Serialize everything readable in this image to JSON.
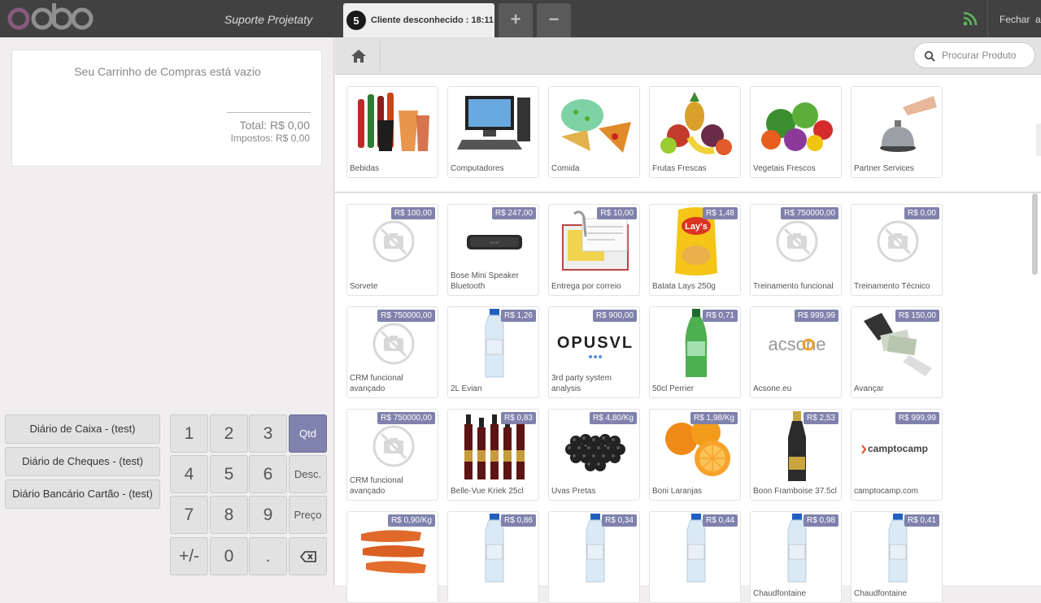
{
  "topbar": {
    "logo": "odoo",
    "shop_name": "Suporte Projetaty",
    "order_tab": {
      "number": "5",
      "label": "Cliente desconhecido : 18:11"
    },
    "add_order": "+",
    "remove_order": "−",
    "close_label": "Fechar",
    "close_extra": "a"
  },
  "cart": {
    "empty_message": "Seu Carrinho de Compras está vazio",
    "total": "Total: R$ 0,00",
    "taxes": "Impostos: R$ 0,00"
  },
  "payment_methods": [
    "Diário de Caixa - (test)",
    "Diário de Cheques - (test)",
    "Diário Bancário Cartão - (test)"
  ],
  "numpad": {
    "digits": [
      "1",
      "2",
      "3",
      "4",
      "5",
      "6",
      "7",
      "8",
      "9",
      "+/-",
      "0",
      "."
    ],
    "modes": [
      "Qtd",
      "Desc.",
      "Preço"
    ],
    "active_mode": "Qtd",
    "backspace_icon": "backspace-icon"
  },
  "search": {
    "placeholder": "Procurar Produto"
  },
  "categories": [
    {
      "name": "Bebidas"
    },
    {
      "name": "Computadores"
    },
    {
      "name": "Comida"
    },
    {
      "name": "Frutas Frescas"
    },
    {
      "name": "Vegetais Frescos"
    },
    {
      "name": "Partner Services"
    }
  ],
  "products": [
    {
      "name": "Sorvete",
      "price": "R$ 100,00",
      "image": "no-photo"
    },
    {
      "name": "Bose Mini Speaker Bluetooth",
      "price": "R$ 247,00",
      "image": "speaker"
    },
    {
      "name": "Entrega por correio",
      "price": "R$ 10,00",
      "image": "mail"
    },
    {
      "name": "Batata Lays 250g",
      "price": "R$ 1,48",
      "image": "chips"
    },
    {
      "name": "Treinamento funcional",
      "price": "R$ 750000,00",
      "image": "no-photo"
    },
    {
      "name": "Treinamento Técnico",
      "price": "R$ 0,00",
      "image": "no-photo"
    },
    {
      "name": "CRM funcional avançado",
      "price": "R$ 750000,00",
      "image": "no-photo"
    },
    {
      "name": "2L Evian",
      "price": "R$ 1,26",
      "image": "bottle"
    },
    {
      "name": "3rd party system analysis",
      "price": "R$ 900,00",
      "image": "opusvl"
    },
    {
      "name": "50cl Perrier",
      "price": "R$ 0,71",
      "image": "green-bottle"
    },
    {
      "name": "Acsone.eu",
      "price": "R$ 999,99",
      "image": "acsone"
    },
    {
      "name": "Avançar",
      "price": "R$ 150,00",
      "image": "money"
    },
    {
      "name": "CRM funcional avançado",
      "price": "R$ 750000,00",
      "image": "no-photo"
    },
    {
      "name": "Belle-Vue Kriek 25cl",
      "price": "R$ 0,83",
      "image": "beer-bottles"
    },
    {
      "name": "Uvas Pretas",
      "price": "R$ 4,80/Kg",
      "image": "grapes"
    },
    {
      "name": "Boni Laranjas",
      "price": "R$ 1,98/Kg",
      "image": "oranges"
    },
    {
      "name": "Boon Framboise 37.5cl",
      "price": "R$ 2,53",
      "image": "dark-bottle"
    },
    {
      "name": "camptocamp.com",
      "price": "R$ 999,99",
      "image": "camptocamp"
    },
    {
      "name": "",
      "price": "R$ 0,90/Kg",
      "image": "carrots"
    },
    {
      "name": "",
      "price": "R$ 0,86",
      "image": "bottle"
    },
    {
      "name": "",
      "price": "R$ 0,34",
      "image": "bottle"
    },
    {
      "name": "",
      "price": "R$ 0,44",
      "image": "bottle"
    },
    {
      "name": "Chaudfontaine",
      "price": "R$ 0,98",
      "image": "bottle"
    },
    {
      "name": "Chaudfontaine",
      "price": "R$ 0,41",
      "image": "bottle"
    }
  ],
  "logos": {
    "opusvl": "OPUSVL",
    "acsone": "acsone",
    "camptocamp": "camptocamp",
    "chips": "Lay's"
  },
  "colors": {
    "accent": "#7f82ac",
    "topbar": "#414141",
    "logo": "#875a7b",
    "rss": "#5cb85c"
  }
}
